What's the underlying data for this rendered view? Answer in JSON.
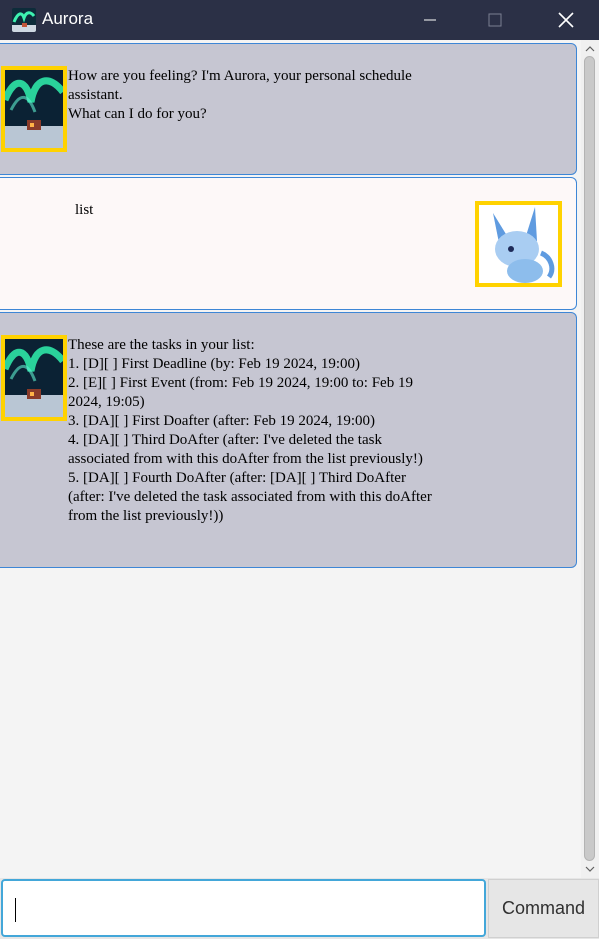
{
  "window": {
    "title": "Aurora",
    "icons": {
      "app": "aurora-app-icon",
      "minimize": "minimize-icon",
      "maximize": "maximize-icon",
      "close": "close-icon"
    }
  },
  "messages": [
    {
      "sender": "bot",
      "avatar": "aurora-avatar",
      "text": "How are you feeling? I'm Aurora, your personal schedule\nassistant.\nWhat can I do for you?"
    },
    {
      "sender": "user",
      "avatar": "user-creature-avatar",
      "text": "list"
    },
    {
      "sender": "bot",
      "avatar": "aurora-avatar",
      "text": "These are the tasks in your list:\n1. [D][ ] First Deadline (by: Feb 19 2024, 19:00)\n2. [E][ ] First Event (from: Feb 19 2024, 19:00 to: Feb 19\n2024, 19:05)\n3. [DA][ ] First Doafter (after: Feb 19 2024, 19:00)\n4. [DA][ ] Third DoAfter (after: I've deleted the task\nassociated from with this doAfter from the list previously!)\n5. [DA][ ] Fourth DoAfter (after: [DA][ ] Third DoAfter\n(after: I've deleted the task associated from with this doAfter\nfrom the list previously!))"
    }
  ],
  "input": {
    "value": "",
    "button_label": "Command"
  },
  "colors": {
    "titlebar": "#2b3046",
    "bot_bubble": "#c6c6d2",
    "user_bubble": "#fdf8f8",
    "bubble_border": "#3d86d6",
    "avatar_border": "#ffd200",
    "input_focus": "#43a7d9"
  }
}
